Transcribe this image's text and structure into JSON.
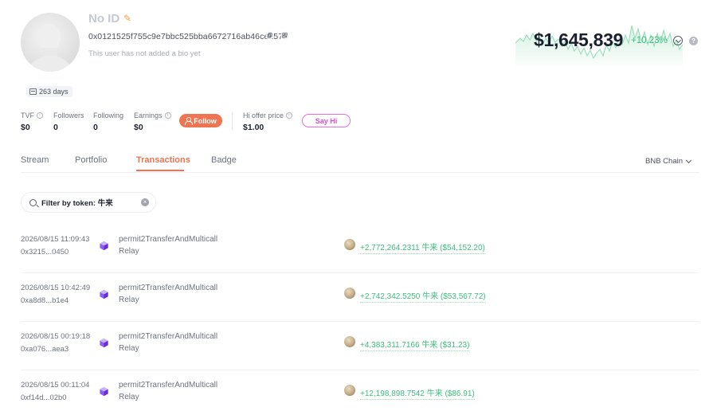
{
  "profile": {
    "name": "No ID",
    "address": "0x0121525f755c9e7bbc525bba6672716ab46ced57",
    "bio": "This user has not added a bio yet",
    "days": "263 days"
  },
  "stats": {
    "tvf_label": "TVF",
    "tvf_value": "$0",
    "followers_label": "Followers",
    "followers_value": "0",
    "following_label": "Following",
    "following_value": "0",
    "earnings_label": "Earnings",
    "earnings_value": "$0",
    "follow_label": "Follow",
    "hi_offer_label": "Hi offer price",
    "hi_offer_value": "$1.00",
    "say_hi_label": "Say Hi"
  },
  "portfolio": {
    "value": "$1,645,839",
    "change": "+10.23%"
  },
  "tabs": [
    {
      "label": "Stream"
    },
    {
      "label": "Portfolio"
    },
    {
      "label": "Transactions",
      "active": true
    },
    {
      "label": "Badge"
    }
  ],
  "chain_select": "BNB Chain",
  "filter": {
    "label": "Filter by token: 牛来"
  },
  "transactions": [
    {
      "time": "2026/08/15 11:09:43",
      "hash": "0x3215...0450",
      "method": "permit2TransferAndMulticall",
      "app": "Relay",
      "amount": "+2,772,264.2311 牛来 ($54,152.20)"
    },
    {
      "time": "2026/08/15 10:42:49",
      "hash": "0xa8d8...b1e4",
      "method": "permit2TransferAndMulticall",
      "app": "Relay",
      "amount": "+2,742,342.5250 牛来 ($53,567.72)"
    },
    {
      "time": "2026/08/15 00:19:18",
      "hash": "0xa076...aea3",
      "method": "permit2TransferAndMulticall",
      "app": "Relay",
      "amount": "+4,383,311.7166 牛来 ($31.23)"
    },
    {
      "time": "2026/08/15 00:11:04",
      "hash": "0xf14d...02b0",
      "method": "permit2TransferAndMulticall",
      "app": "Relay",
      "amount": "+12,198,898.7542 牛来 ($86.91)"
    }
  ],
  "colors": {
    "accent": "#ee7452",
    "positive": "#3bbf7c",
    "say_hi": "#e86fd8"
  }
}
